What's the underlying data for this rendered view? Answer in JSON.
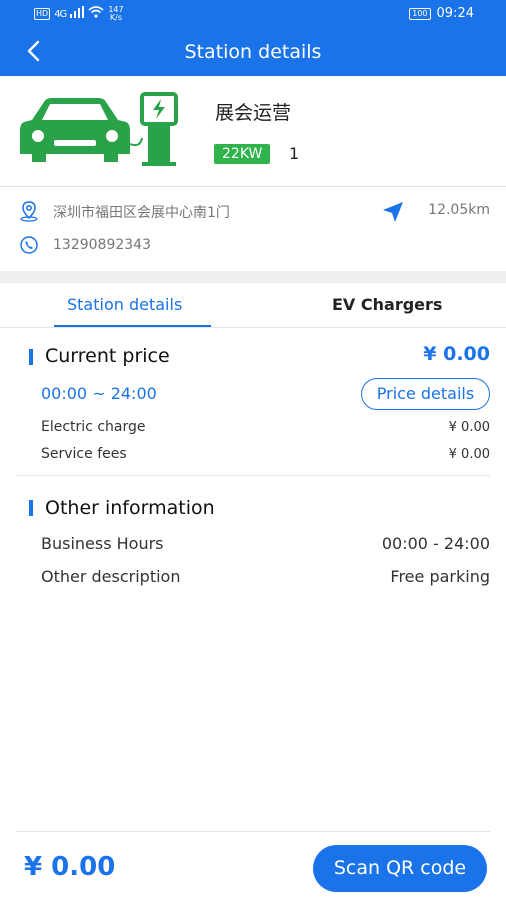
{
  "status_bar": {
    "hd": "HD",
    "network": "4G",
    "speed_value": "147",
    "speed_unit": "K/s",
    "battery": "100",
    "time": "09:24"
  },
  "header": {
    "title": "Station details",
    "back_icon": "chevron-left-icon"
  },
  "station": {
    "name": "展会运营",
    "power": "22KW",
    "charger_count": "1",
    "address": "深圳市福田区会展中心南1门",
    "distance": "12.05km",
    "phone": "13290892343",
    "icons": [
      "car-icon",
      "charging-station-icon",
      "location-pin-icon",
      "navigation-arrow-icon",
      "phone-icon"
    ]
  },
  "tabs": [
    {
      "label": "Station details",
      "active": true
    },
    {
      "label": "EV Chargers",
      "active": false
    }
  ],
  "current_price": {
    "title": "Current price",
    "total": "¥ 0.00",
    "time_range": "00:00 ~ 24:00",
    "details_button": "Price details",
    "fees": [
      {
        "label": "Electric charge",
        "value": "¥ 0.00"
      },
      {
        "label": "Service fees",
        "value": "¥ 0.00"
      }
    ]
  },
  "other_info": {
    "title": "Other information",
    "rows": [
      {
        "label": "Business Hours",
        "value": "00:00 - 24:00"
      },
      {
        "label": "Other description",
        "value": "Free parking"
      }
    ]
  },
  "bottom": {
    "price": "¥ 0.00",
    "scan_button": "Scan QR code"
  },
  "colors": {
    "primary": "#1a73e8",
    "badge_green": "#2fb34a",
    "art_green": "#2aa24a"
  }
}
